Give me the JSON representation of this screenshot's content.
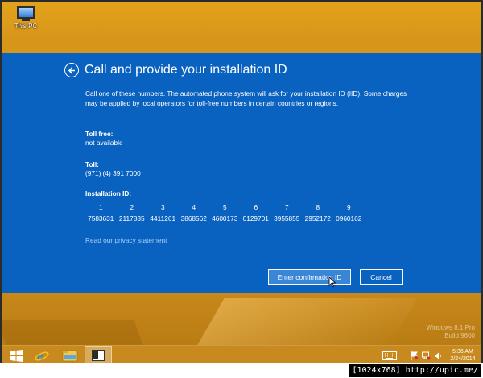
{
  "desktop": {
    "icon_label": "This PC",
    "watermark_line1": "Windows 8.1 Pro",
    "watermark_line2": "Build 9600"
  },
  "dialog": {
    "title": "Call and provide your installation ID",
    "description": "Call one of these numbers. The automated phone system will ask for your installation ID (IID). Some charges may be applied by local operators for toll-free numbers in certain countries or regions.",
    "toll_free": {
      "label": "Toll free:",
      "value": "not available"
    },
    "toll": {
      "label": "Toll:",
      "value": "(971) (4) 391 7000"
    },
    "installation_id": {
      "label": "Installation ID:",
      "groups": [
        "1",
        "2",
        "3",
        "4",
        "5",
        "6",
        "7",
        "8",
        "9"
      ],
      "values": [
        "7583631",
        "2117835",
        "4411261",
        "3868562",
        "4600173",
        "0129701",
        "3955855",
        "2952172",
        "0960162"
      ]
    },
    "privacy_link": "Read our privacy statement",
    "confirm_button": "Enter confirmation ID",
    "cancel_button": "Cancel"
  },
  "taskbar": {
    "time": "5:36 AM",
    "date": "2/24/2014"
  },
  "footer": {
    "tag": "[1024x768] http://upic.me/"
  },
  "colors": {
    "panel": "#0a62c0",
    "desktop": "#d7961a",
    "link": "#a9cef7"
  },
  "icons": [
    "this-pc-icon",
    "back-arrow-icon",
    "windows-start-icon",
    "internet-explorer-icon",
    "file-explorer-icon",
    "app-window-icon",
    "keyboard-icon",
    "flag-icon",
    "network-icon",
    "volume-icon",
    "mouse-cursor-icon"
  ]
}
